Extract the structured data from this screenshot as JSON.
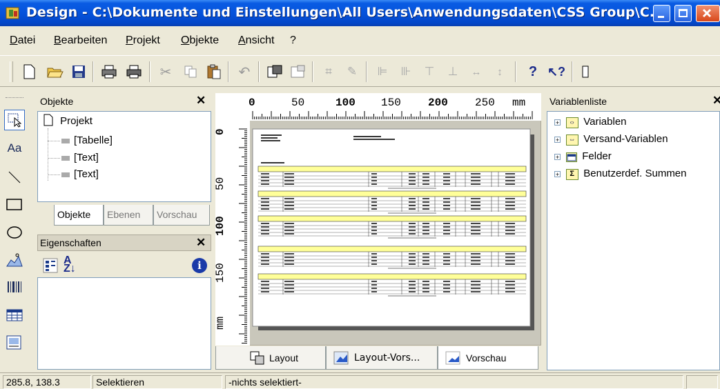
{
  "window": {
    "title": "Design - C:\\Dokumente und Einstellungen\\All Users\\Anwendungsdaten\\CSS Group\\C...",
    "app_icon": "design-app-icon"
  },
  "menu": [
    "Datei",
    "Bearbeiten",
    "Projekt",
    "Objekte",
    "Ansicht",
    "?"
  ],
  "objects_panel": {
    "title": "Objekte",
    "root": "Projekt",
    "items": [
      "[Tabelle]",
      "[Text]",
      "[Text]"
    ],
    "tabs": [
      "Objekte",
      "Ebenen",
      "Vorschau"
    ]
  },
  "properties_panel": {
    "title": "Eigenschaften"
  },
  "ruler": {
    "top": [
      "0",
      "50",
      "100",
      "150",
      "200",
      "250"
    ],
    "top_unit": "mm",
    "left": [
      "0",
      "50",
      "100",
      "150"
    ],
    "left_unit": "mm"
  },
  "bottom_tabs": [
    "Layout",
    "Layout-Vors...",
    "Vorschau"
  ],
  "variables_panel": {
    "title": "Variablenliste",
    "items": [
      "Variablen",
      "Versand-Variablen",
      "Felder",
      "Benutzerdef. Summen"
    ]
  },
  "status": {
    "coords": "285.8, 138.3",
    "mode": "Selektieren",
    "selection": "-nichts selektiert-"
  },
  "colors": {
    "titlebar": "#0553dc",
    "highlight_row": "#ffff99"
  }
}
